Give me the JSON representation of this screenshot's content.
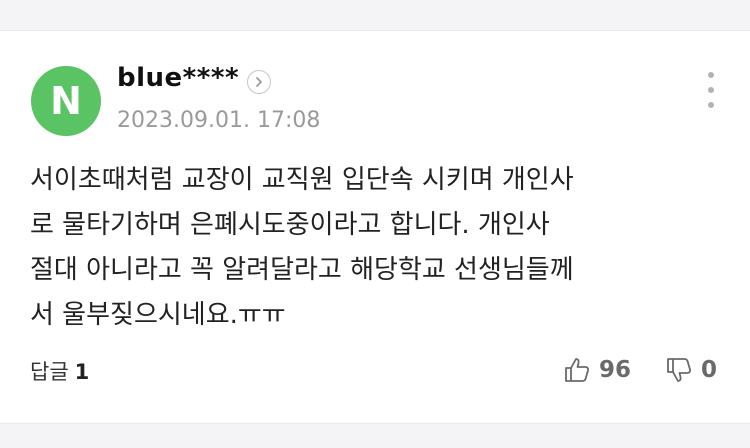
{
  "comment": {
    "avatar_letter": "N",
    "username": "blue****",
    "timestamp": "2023.09.01. 17:08",
    "body": "서이초때처럼 교장이 교직원 입단속 시키며 개인사\n로 물타기하며 은폐시도중이라고 합니다. 개인사\n절대 아니라고 꼭 알려달라고 해당학교 선생님들께\n서 울부짖으시네요.ㅠㅠ"
  },
  "actions": {
    "reply_label": "답글",
    "reply_count": "1",
    "like_count": "96",
    "dislike_count": "0"
  },
  "icons": {
    "profile": "chevron-right-icon",
    "menu": "more-vertical-icon",
    "like": "thumbs-up-icon",
    "dislike": "thumbs-down-icon"
  },
  "colors": {
    "avatar_bg": "#5ac363",
    "timestamp": "#9a9a9a",
    "count": "#6a6a6a"
  }
}
